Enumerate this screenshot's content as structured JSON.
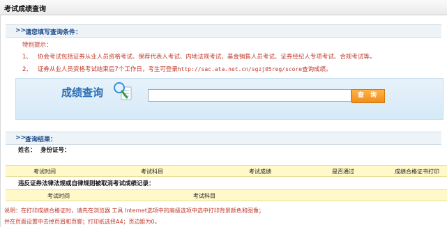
{
  "page": {
    "title": "考试成绩查询"
  },
  "condition": {
    "arrow": ">>",
    "title": "请您填写查询条件："
  },
  "notice": {
    "title": "特别提示：",
    "items": [
      {
        "num": "1、",
        "text": "协会考试包括证券从业人员资格考试、保荐代表人考试、内地法规考试、基金销售人员考试、证券经纪人专项考试、合规考试等。"
      },
      {
        "num": "2、",
        "text_before": "证券从业人员资格考试结束后7个工作日，考生可登录",
        "url": "http://sac.ata.net.cn/sgzj05reg/score",
        "text_after": "查询成绩。"
      }
    ]
  },
  "query": {
    "label": "成绩查询",
    "input_value": "",
    "button_label": "查 询"
  },
  "result": {
    "arrow": ">>",
    "title": "查询结果：",
    "name_label": "姓名：",
    "id_label": "身份证号："
  },
  "scores_table": {
    "headers": [
      "考试时间",
      "考试科目",
      "考试成绩",
      "是否通过",
      "成绩合格证书打印"
    ]
  },
  "violations": {
    "title": "违反证券法律法规或自律规则被取消考试成绩记录：",
    "headers": [
      "考试时间",
      "考试科目"
    ]
  },
  "footnotes": [
    "说明：在打印成绩合格证时，请先在浏览器 工具 Internet选项中的高级选项中选中打印背景颜色和图像；",
    "并在页面设置中去掉页眉和页脚；打印纸选择A4；页边距为0。"
  ],
  "colors": {
    "notice_red": "#c0392b",
    "heading_blue": "#1a4a8a",
    "button_orange": "#f28c1e",
    "table_header_yellow": "#fff8c8"
  }
}
